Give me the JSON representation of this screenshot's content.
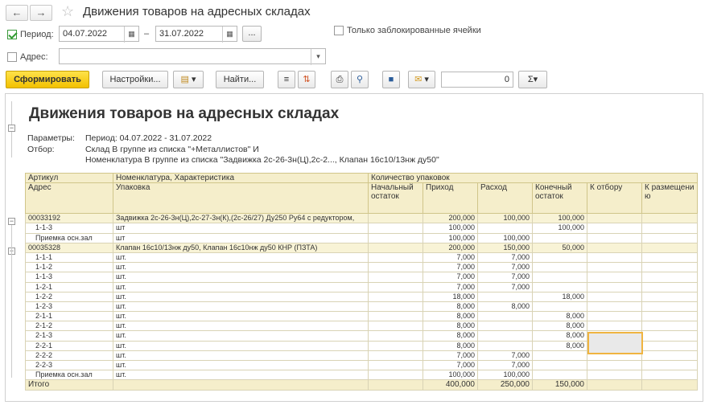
{
  "window": {
    "title": "Движения товаров на адресных складах"
  },
  "nav": {
    "back": "←",
    "forward": "→",
    "star": "☆"
  },
  "filters": {
    "period_label": "Период:",
    "period_checked": true,
    "date_from": "04.07.2022",
    "date_to": "31.07.2022",
    "dash": "–",
    "more": "...",
    "only_locked_label": "Только заблокированные ячейки",
    "address_label": "Адрес:",
    "address_value": "",
    "calendar_icon": "calendar-icon",
    "dropdown_icon": "chevron-down-icon"
  },
  "toolbar": {
    "generate": "Сформировать",
    "settings": "Настройки...",
    "find": "Найти...",
    "number_value": "0",
    "sigma": "Σ",
    "caret": "▾"
  },
  "report": {
    "title": "Движения товаров на адресных складах",
    "params_label": "Параметры:",
    "params_value": "Период: 04.07.2022 - 31.07.2022",
    "filter_label": "Отбор:",
    "filter_line1": "Склад В группе из списка \"+Металлистов\" И",
    "filter_line2": "Номенклатура В группе из списка \"Задвижка 2с-26-3н(Ц),2с-2..., Клапан 16с10/13нж ду50\""
  },
  "table": {
    "h1": {
      "c1": "Артикул",
      "c2": "Номенклатура, Характеристика",
      "c3": "Количество упаковок"
    },
    "h2": {
      "c1": "Адрес",
      "c2": "Упаковка",
      "c3": "Начальный остаток",
      "c4": "Приход",
      "c5": "Расход",
      "c6": "Конечный остаток",
      "c7": "К отбору",
      "c8": "К размещению"
    },
    "rows": [
      {
        "t": "grp",
        "a": "00033192",
        "b": "Задвижка 2с-26-3н(Ц),2с-27-3н(К),(2с-26/27) Ду250 Ру64 с редуктором,",
        "c": "",
        "d": "200,000",
        "e": "100,000",
        "f": "100,000",
        "g": "",
        "h": ""
      },
      {
        "t": "row",
        "a": "1-1-3",
        "b": "шт",
        "c": "",
        "d": "100,000",
        "e": "",
        "f": "100,000",
        "g": "",
        "h": ""
      },
      {
        "t": "row",
        "a": "Приемка осн.зал",
        "b": "шт",
        "c": "",
        "d": "100,000",
        "e": "100,000",
        "f": "",
        "g": "",
        "h": ""
      },
      {
        "t": "grp",
        "a": "00035328",
        "b": "Клапан 16с10/13нж ду50, Клапан 16с10нж ду50 КНР (ПЗТА)",
        "c": "",
        "d": "200,000",
        "e": "150,000",
        "f": "50,000",
        "g": "",
        "h": ""
      },
      {
        "t": "row",
        "a": "1-1-1",
        "b": "шт.",
        "c": "",
        "d": "7,000",
        "e": "7,000",
        "f": "",
        "g": "",
        "h": ""
      },
      {
        "t": "row",
        "a": "1-1-2",
        "b": "шт.",
        "c": "",
        "d": "7,000",
        "e": "7,000",
        "f": "",
        "g": "",
        "h": ""
      },
      {
        "t": "row",
        "a": "1-1-3",
        "b": "шт.",
        "c": "",
        "d": "7,000",
        "e": "7,000",
        "f": "",
        "g": "",
        "h": ""
      },
      {
        "t": "row",
        "a": "1-2-1",
        "b": "шт.",
        "c": "",
        "d": "7,000",
        "e": "7,000",
        "f": "",
        "g": "",
        "h": ""
      },
      {
        "t": "row",
        "a": "1-2-2",
        "b": "шт.",
        "c": "",
        "d": "18,000",
        "e": "",
        "f": "18,000",
        "g": "",
        "h": ""
      },
      {
        "t": "row",
        "a": "1-2-3",
        "b": "шт.",
        "c": "",
        "d": "8,000",
        "e": "8,000",
        "f": "",
        "g": "",
        "h": ""
      },
      {
        "t": "row",
        "a": "2-1-1",
        "b": "шт.",
        "c": "",
        "d": "8,000",
        "e": "",
        "f": "8,000",
        "g": "",
        "h": ""
      },
      {
        "t": "row",
        "a": "2-1-2",
        "b": "шт.",
        "c": "",
        "d": "8,000",
        "e": "",
        "f": "8,000",
        "g": "",
        "h": ""
      },
      {
        "t": "row",
        "a": "2-1-3",
        "b": "шт.",
        "c": "",
        "d": "8,000",
        "e": "",
        "f": "8,000",
        "g": "",
        "h": ""
      },
      {
        "t": "row",
        "a": "2-2-1",
        "b": "шт.",
        "c": "",
        "d": "8,000",
        "e": "",
        "f": "8,000",
        "g": "",
        "h": ""
      },
      {
        "t": "row",
        "a": "2-2-2",
        "b": "шт.",
        "c": "",
        "d": "7,000",
        "e": "7,000",
        "f": "",
        "g": "",
        "h": ""
      },
      {
        "t": "row",
        "a": "2-2-3",
        "b": "шт.",
        "c": "",
        "d": "7,000",
        "e": "7,000",
        "f": "",
        "g": "",
        "h": ""
      },
      {
        "t": "row",
        "a": "Приемка осн.зал",
        "b": "шт.",
        "c": "",
        "d": "100,000",
        "e": "100,000",
        "f": "",
        "g": "",
        "h": ""
      },
      {
        "t": "tot",
        "a": "Итого",
        "b": "",
        "c": "",
        "d": "400,000",
        "e": "250,000",
        "f": "150,000",
        "g": "",
        "h": ""
      }
    ]
  }
}
